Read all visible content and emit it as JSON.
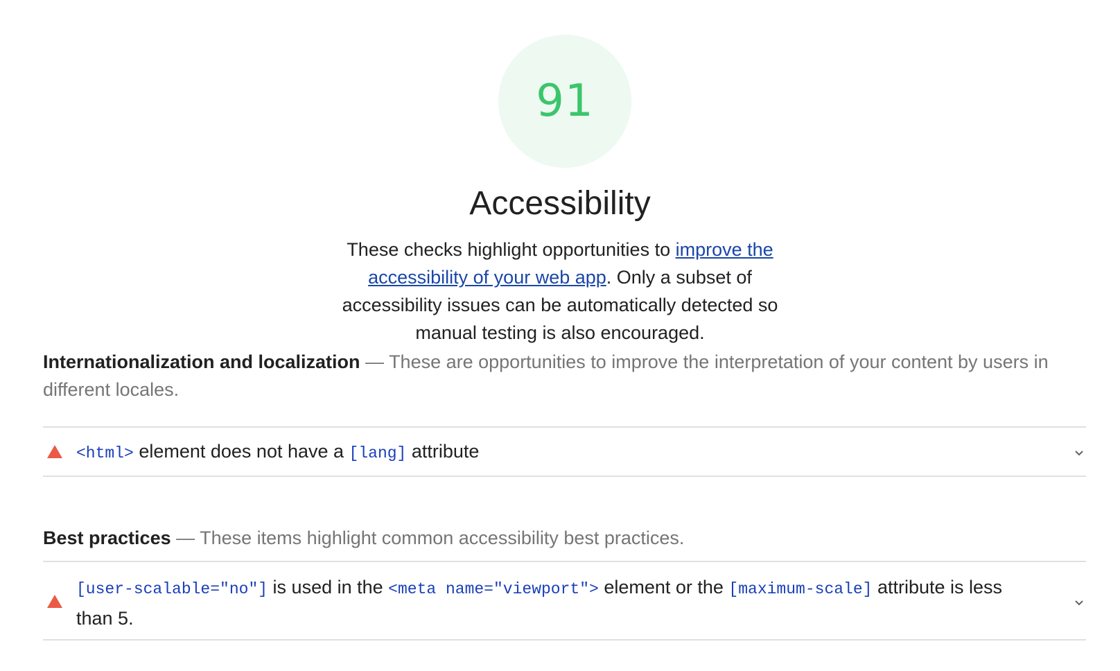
{
  "score": "91",
  "category": {
    "title": "Accessibility",
    "description_prefix": "These checks highlight opportunities to ",
    "description_link": "improve the accessibility of your web app",
    "description_suffix": ". Only a subset of accessibility issues can be automatically detected so manual testing is also encouraged."
  },
  "groups": [
    {
      "title": "Internationalization and localization",
      "separator": " — ",
      "description": "These are opportunities to improve the interpretation of your content by users in different locales.",
      "audits": [
        {
          "status_icon": "fail-triangle-icon",
          "parts": [
            {
              "code": "<html>"
            },
            {
              "text": " element does not have a "
            },
            {
              "code": "[lang]"
            },
            {
              "text": " attribute"
            }
          ]
        }
      ]
    },
    {
      "title": "Best practices",
      "separator": " — ",
      "description": "These items highlight common accessibility best practices.",
      "audits": [
        {
          "status_icon": "fail-triangle-icon",
          "parts": [
            {
              "code": "[user-scalable=\"no\"]"
            },
            {
              "text": " is used in the "
            },
            {
              "code": "<meta name=\"viewport\">"
            },
            {
              "text": " element or the "
            },
            {
              "code": "[maximum-scale]"
            },
            {
              "text": " attribute is less than 5."
            }
          ]
        }
      ]
    }
  ],
  "colors": {
    "score_pass": "#3cc56c",
    "gauge_bg": "#eef9f1",
    "fail": "#eb5a46",
    "link": "#1a46a8",
    "code": "#1a3fb8"
  }
}
